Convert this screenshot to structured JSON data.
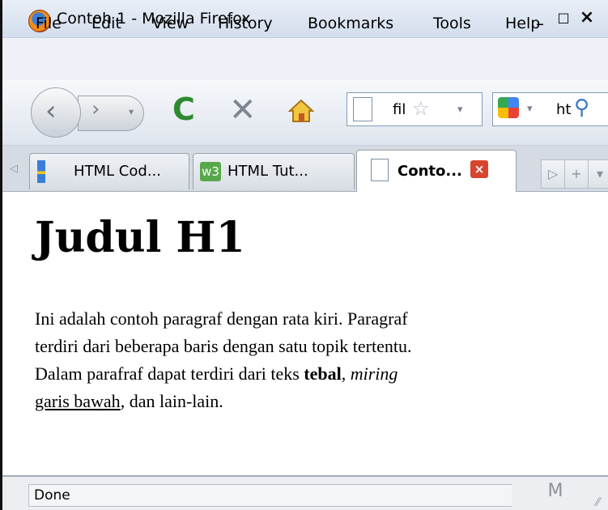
{
  "window": {
    "title": "Contoh 1 - Mozilla Firefox",
    "controls": {
      "minimize": "_",
      "maximize": "□",
      "close": "×"
    }
  },
  "menu": {
    "items": [
      "File",
      "Edit",
      "View",
      "History",
      "Bookmarks",
      "Tools",
      "Help"
    ]
  },
  "navbar": {
    "back_icon": "back-arrow-icon",
    "forward_icon": "forward-arrow-icon",
    "reload_glyph": "C",
    "stop_glyph": "✕",
    "url_value": "fil",
    "search_value": "ht"
  },
  "tabs": [
    {
      "label": "HTML Cod...",
      "icon": "blue-bookmark-icon",
      "active": false
    },
    {
      "label": "HTML Tut...",
      "icon": "w3-icon",
      "active": false
    },
    {
      "label": "Conto...",
      "icon": "page-icon",
      "active": true
    }
  ],
  "tab_controls": {
    "scroll_right": "▷",
    "new_tab": "+",
    "list": "▾"
  },
  "page": {
    "heading": "Judul H1",
    "lines": {
      "l1": "Ini adalah contoh paragraf dengan rata kiri. Paragraf",
      "l2": "terdiri dari beberapa baris dengan satu topik tertentu.",
      "l3_pre": "Dalam parafraf dapat terdiri dari teks ",
      "l3_bold": "tebal",
      "l3_mid": ", ",
      "l3_italic": "miring",
      "l4_underline": "garis bawah",
      "l4_post": ", dan lain-lain."
    }
  },
  "status": {
    "text": "Done",
    "gmail_icon": "M"
  },
  "colors": {
    "reload": "#2f8a2f",
    "tab_close": "#d6462f",
    "titlebar": "#d2dded"
  }
}
